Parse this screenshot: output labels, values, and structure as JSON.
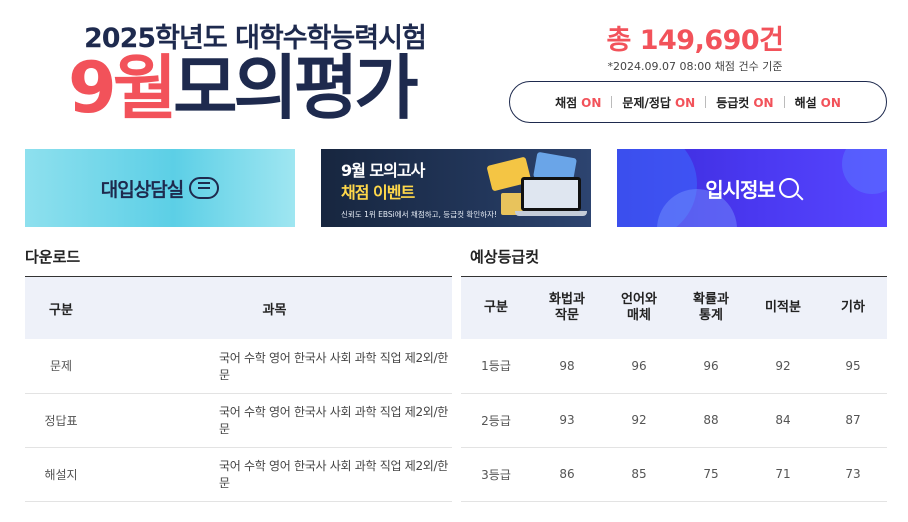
{
  "hero": {
    "subtitle": "2025학년도 대학수학능력시험",
    "title_month": "9월",
    "title_rest": "모의평가"
  },
  "summary": {
    "total": "총 149,690건",
    "note": "*2024.09.07 08:00 채점 건수 기준"
  },
  "status": [
    {
      "label": "채점",
      "state": "ON"
    },
    {
      "label": "문제/정답",
      "state": "ON"
    },
    {
      "label": "등급컷",
      "state": "ON"
    },
    {
      "label": "해설",
      "state": "ON"
    }
  ],
  "banners": {
    "consult": {
      "text": "대입상담실",
      "icon": "speech-bubble-icon"
    },
    "event": {
      "line1": "9월 모의고사",
      "line2": "채점 이벤트",
      "line3": "신뢰도 1위 EBSi에서 채점하고, 등급컷 확인하자!"
    },
    "info": {
      "text": "입시정보",
      "icon": "magnifier-icon"
    }
  },
  "download": {
    "title": "다운로드",
    "headers": [
      "구분",
      "과목"
    ],
    "rows": [
      {
        "type": "문제",
        "subjects": "국어 수학 영어 한국사 사회 과학 직업 제2외/한문"
      },
      {
        "type": "정답표",
        "subjects": "국어 수학 영어 한국사 사회 과학 직업 제2외/한문"
      },
      {
        "type": "해설지",
        "subjects": "국어 수학 영어 한국사 사회 과학 직업 제2외/한문"
      }
    ]
  },
  "grade_cut": {
    "title": "예상등급컷",
    "headers": [
      "구분",
      "화법과\n작문",
      "언어와\n매체",
      "확률과\n통계",
      "미적분",
      "기하"
    ],
    "rows": [
      {
        "grade": "1등급",
        "values": [
          "98",
          "96",
          "96",
          "92",
          "95"
        ]
      },
      {
        "grade": "2등급",
        "values": [
          "93",
          "92",
          "88",
          "84",
          "87"
        ]
      },
      {
        "grade": "3등급",
        "values": [
          "86",
          "85",
          "75",
          "71",
          "73"
        ]
      }
    ]
  },
  "colors": {
    "accent": "#f2525a",
    "navy": "#1e2a4e",
    "header_bg": "#eef1f9"
  }
}
